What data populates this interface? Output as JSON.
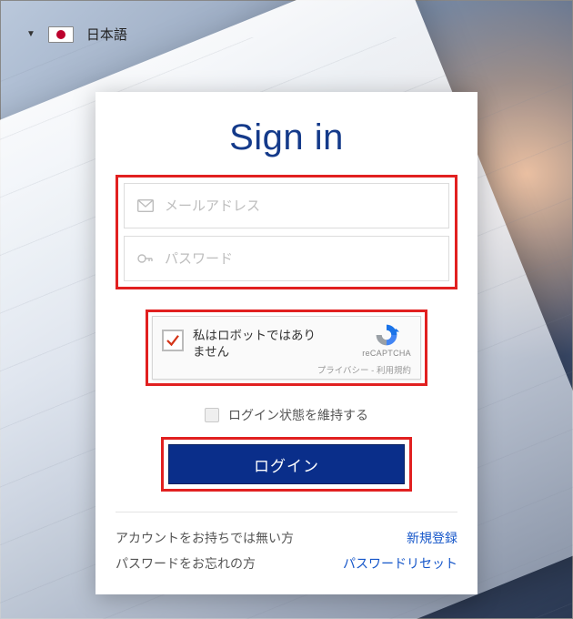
{
  "lang": {
    "label": "日本語"
  },
  "card": {
    "title": "Sign in",
    "email_ph": "メールアドレス",
    "password_ph": "パスワード",
    "recaptcha": {
      "label": "私はロボットではありません",
      "brand": "reCAPTCHA",
      "privacy": "プライバシー",
      "terms": "利用規約"
    },
    "remember_label": "ログイン状態を維持する",
    "login_label": "ログイン",
    "links": {
      "no_account": "アカウントをお持ちでは無い方",
      "signup": "新規登録",
      "forgot": "パスワードをお忘れの方",
      "reset": "パスワードリセット"
    }
  },
  "colors": {
    "highlight": "#e12020",
    "primary": "#0a2e8a",
    "title": "#143a8a",
    "link": "#1556c9"
  }
}
